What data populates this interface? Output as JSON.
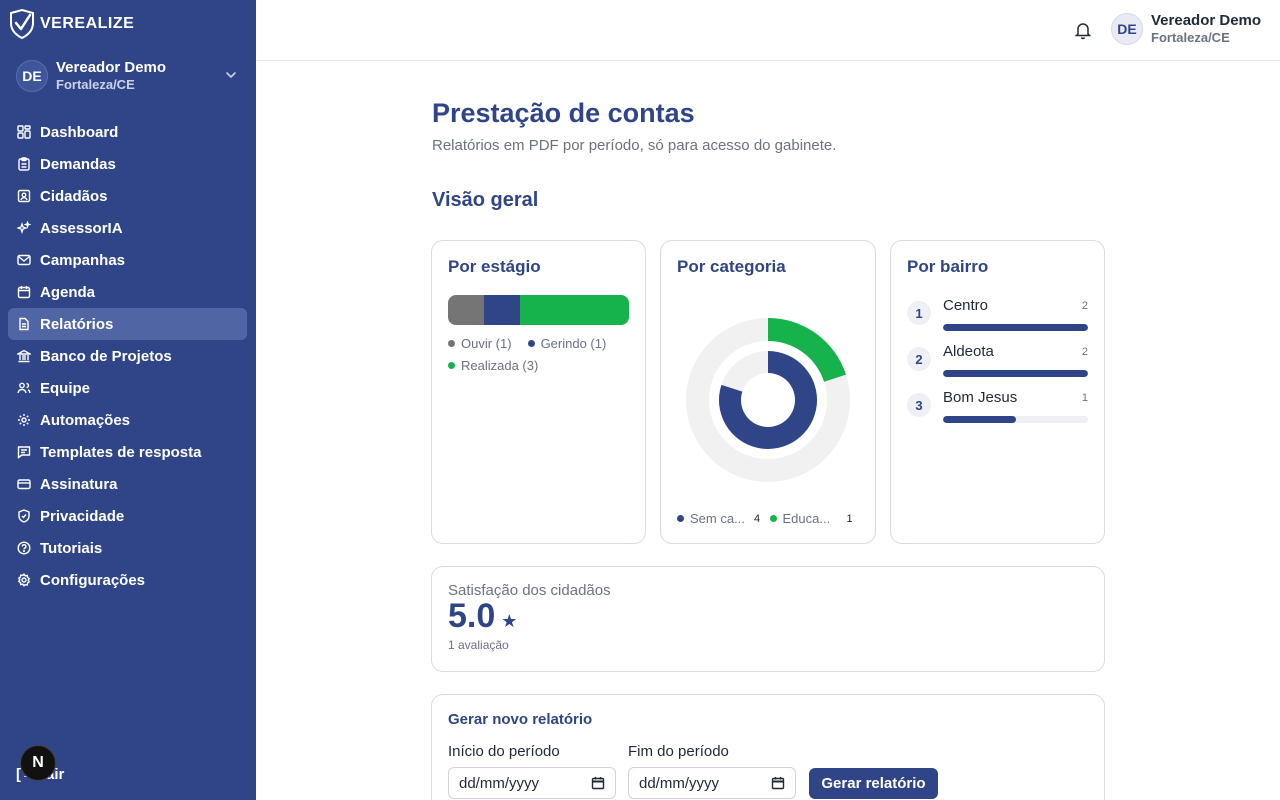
{
  "app": {
    "logo_text": "VEREALIZE"
  },
  "sidebar": {
    "user": {
      "initials": "DE",
      "name": "Vereador Demo",
      "city": "Fortaleza/CE"
    },
    "items": [
      {
        "label": "Dashboard",
        "icon": "dashboard-icon"
      },
      {
        "label": "Demandas",
        "icon": "clipboard-icon"
      },
      {
        "label": "Cidadãos",
        "icon": "id-card-icon"
      },
      {
        "label": "AssessorIA",
        "icon": "sparkles-icon"
      },
      {
        "label": "Campanhas",
        "icon": "mail-icon"
      },
      {
        "label": "Agenda",
        "icon": "calendar-icon"
      },
      {
        "label": "Relatórios",
        "icon": "file-icon",
        "active": true
      },
      {
        "label": "Banco de Projetos",
        "icon": "bank-icon"
      },
      {
        "label": "Equipe",
        "icon": "users-icon"
      },
      {
        "label": "Automações",
        "icon": "gear-icon"
      },
      {
        "label": "Templates de resposta",
        "icon": "message-icon"
      },
      {
        "label": "Assinatura",
        "icon": "credit-card-icon"
      },
      {
        "label": "Privacidade",
        "icon": "shield-icon"
      },
      {
        "label": "Tutoriais",
        "icon": "help-icon"
      },
      {
        "label": "Configurações",
        "icon": "settings-icon"
      }
    ],
    "logout_label": "Sair",
    "next_badge": "N"
  },
  "topbar": {
    "initials": "DE",
    "name": "Vereador Demo",
    "city": "Fortaleza/CE"
  },
  "main": {
    "title": "Prestação de contas",
    "subtitle": "Relatórios em PDF por período, só para acesso do gabinete.",
    "overview_title": "Visão geral",
    "stage_card": {
      "title": "Por estágio",
      "stages": [
        {
          "label": "Ouvir (1)",
          "value": 1,
          "color": "#757575"
        },
        {
          "label": "Gerindo (1)",
          "value": 1,
          "color": "#2f4587"
        },
        {
          "label": "Realizada (3)",
          "value": 3,
          "color": "#16b24b"
        }
      ]
    },
    "category_card": {
      "title": "Por categoria",
      "categories": [
        {
          "name": "Sem categoria",
          "short": "Sem ca...",
          "count": "4",
          "value": 4,
          "color": "#2f4587"
        },
        {
          "name": "Educação",
          "short": "Educa...",
          "count": "1",
          "value": 1,
          "color": "#16b24b"
        }
      ]
    },
    "bairro_card": {
      "title": "Por bairro",
      "items": [
        {
          "rank": "1",
          "name": "Centro",
          "count": "2",
          "fraction": 1.0
        },
        {
          "rank": "2",
          "name": "Aldeota",
          "count": "2",
          "fraction": 1.0
        },
        {
          "rank": "3",
          "name": "Bom Jesus",
          "count": "1",
          "fraction": 0.5
        }
      ]
    },
    "satisfaction": {
      "label": "Satisfação dos cidadãos",
      "score": "5.0",
      "star": "★",
      "count": "1 avaliação"
    },
    "report_form": {
      "title": "Gerar novo relatório",
      "start_label": "Início do período",
      "end_label": "Fim do período",
      "date_placeholder": "dd/mm/yyyy",
      "button_label": "Gerar relatório"
    }
  }
}
